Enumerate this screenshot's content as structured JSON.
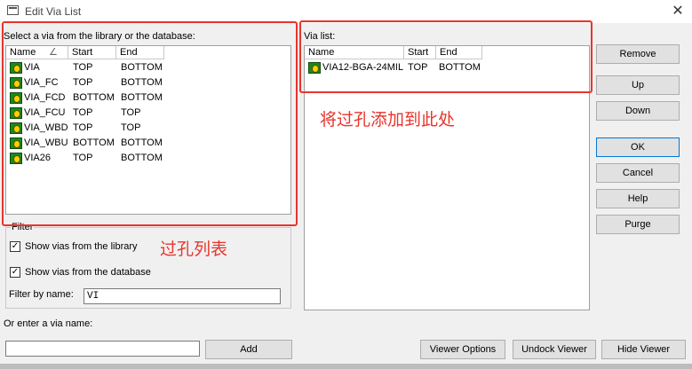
{
  "window": {
    "title": "Edit Via List",
    "close_glyph": "✕"
  },
  "library": {
    "label": "Select a via from the library or the database:",
    "columns": [
      "Name",
      "Start",
      "End"
    ],
    "sort_glyph": "∠",
    "rows": [
      {
        "name": "VIA",
        "start": "TOP",
        "end": "BOTTOM"
      },
      {
        "name": "VIA_FC",
        "start": "TOP",
        "end": "BOTTOM"
      },
      {
        "name": "VIA_FCD",
        "start": "BOTTOM",
        "end": "BOTTOM"
      },
      {
        "name": "VIA_FCU",
        "start": "TOP",
        "end": "TOP"
      },
      {
        "name": "VIA_WBD",
        "start": "TOP",
        "end": "TOP"
      },
      {
        "name": "VIA_WBU",
        "start": "BOTTOM",
        "end": "BOTTOM"
      },
      {
        "name": "VIA26",
        "start": "TOP",
        "end": "BOTTOM"
      }
    ]
  },
  "via_list": {
    "label": "Via list:",
    "columns": [
      "Name",
      "Start",
      "End"
    ],
    "rows": [
      {
        "name": "VIA12-BGA-24MIL",
        "start": "TOP",
        "end": "BOTTOM"
      }
    ]
  },
  "filter": {
    "label": "Filter",
    "show_library": "Show vias from the library",
    "show_database": "Show vias from the database",
    "check_glyph": "✓",
    "filter_by_name_label": "Filter by name:",
    "filter_value": "VI"
  },
  "enter_via": {
    "label": "Or enter a via name:",
    "value": ""
  },
  "buttons": {
    "remove": "Remove",
    "up": "Up",
    "down": "Down",
    "ok": "OK",
    "cancel": "Cancel",
    "help": "Help",
    "purge": "Purge",
    "add": "Add",
    "viewer_options": "Viewer Options",
    "undock_viewer": "Undock Viewer",
    "hide_viewer": "Hide Viewer"
  },
  "annotations": {
    "add_here": "将过孔添加到此处",
    "via_list": "过孔列表",
    "color": "#e8352c"
  }
}
